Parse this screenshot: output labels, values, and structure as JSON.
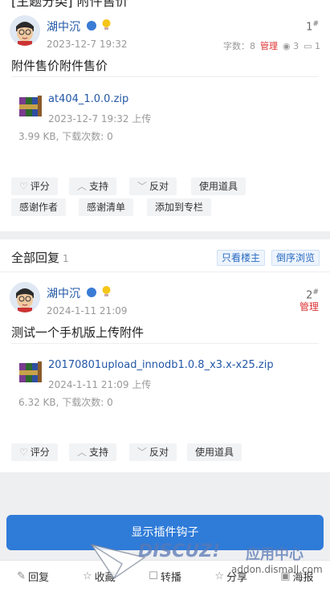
{
  "thread": {
    "title_partial": "[主题分类] 附件售价"
  },
  "posts": [
    {
      "author": "湖中沉",
      "date": "2023-12-7 19:32",
      "floor": "1",
      "word_count": "字数：8",
      "manage": "管理",
      "views": "3",
      "replies": "1",
      "title": "附件售价附件售价",
      "attachment": {
        "name": "at404_1.0.0.zip",
        "uploaded": "2023-12-7 19:32 上传",
        "info": "3.99 KB, 下载次数: 0"
      },
      "actions": [
        "评分",
        "支持",
        "反对",
        "使用道具",
        "感谢作者",
        "感谢清单",
        "添加到专栏"
      ]
    },
    {
      "author": "湖中沉",
      "date": "2024-1-11 21:09",
      "floor": "2",
      "manage": "管理",
      "title": "测试一个手机版上传附件",
      "attachment": {
        "name": "20170801upload_innodb1.0.8_x3.x-x25.zip",
        "uploaded": "2024-1-11 21:09 上传",
        "info": "6.32 KB, 下载次数: 0"
      },
      "actions": [
        "评分",
        "支持",
        "反对",
        "使用道具"
      ]
    }
  ],
  "replies_section": {
    "title": "全部回复",
    "count": "1",
    "only_author": "只看楼主",
    "reverse": "倒序浏览"
  },
  "show_hook_button": "显示插件钩子",
  "bottom_bar": {
    "reply": "回复",
    "favorite": "收藏",
    "repost": "转播",
    "share": "分享",
    "post": "海报"
  },
  "watermark": {
    "brand": "DISCUZ!",
    "center": "应用中心",
    "url": "addon.dismall.com"
  },
  "colors": {
    "link": "#2257a6",
    "accent": "#2f7bd8",
    "manage": "#d33333"
  }
}
